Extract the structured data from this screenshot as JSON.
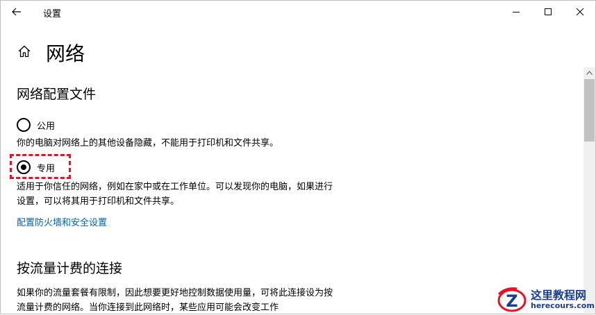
{
  "window": {
    "title": "设置",
    "back_icon": "back-arrow-icon",
    "minimize_icon": "minimize-icon",
    "maximize_icon": "maximize-icon",
    "close_icon": "close-icon"
  },
  "header": {
    "home_icon": "home-icon",
    "title": "网络"
  },
  "network_profile": {
    "section_title": "网络配置文件",
    "options": [
      {
        "label": "公用",
        "selected": false,
        "description": "你的电脑对网络上的其他设备隐藏，不能用于打印机和文件共享。"
      },
      {
        "label": "专用",
        "selected": true,
        "description": "适用于你信任的网络，例如在家中或在工作单位。可以发现你的电脑，如果进行设置，可以将其用于打印机和文件共享。"
      }
    ],
    "firewall_link": "配置防火墙和安全设置",
    "highlight_color": "#e81123"
  },
  "metered": {
    "section_title": "按流量计费的连接",
    "description": "如果你的流量套餐有限制，因此想要更好地控制数据使用量，可将此连接设为按流量计费的网络。当你连接到此网络时，某些应用可能会改变工作"
  },
  "watermark": {
    "badge_letter": "Z",
    "title": "这里教程网",
    "url": "herecours.com"
  },
  "colors": {
    "link": "#0063b1",
    "accent_red": "#e81123",
    "watermark_blue": "#1a3f8f"
  }
}
